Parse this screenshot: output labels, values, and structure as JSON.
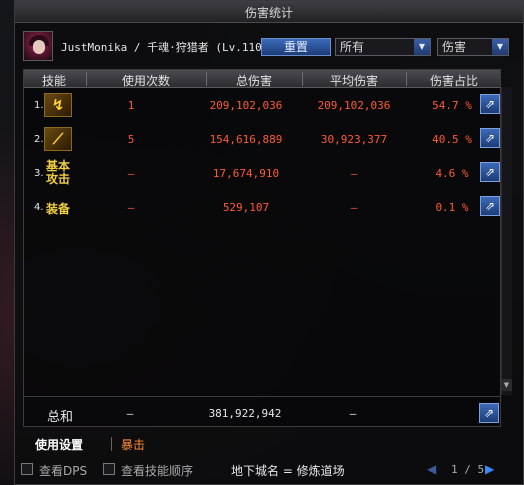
{
  "window": {
    "title": "伤害统计"
  },
  "player": {
    "name": "JustMonika / 千魂·狩猎者 (Lv.110)"
  },
  "controls": {
    "reset_label": "重置",
    "filter_select": "所有",
    "type_select": "伤害"
  },
  "table": {
    "headers": [
      "技能",
      "使用次数",
      "总伤害",
      "平均伤害",
      "伤害占比"
    ],
    "rows": [
      {
        "rank": "1.",
        "icon": "yellow-swirl-skill-icon",
        "uses": "1",
        "total": "209,102,036",
        "average": "209,102,036",
        "share": "54.7 %"
      },
      {
        "rank": "2.",
        "icon": "golden-spear-skill-icon",
        "uses": "5",
        "total": "154,616,889",
        "average": "30,923,377",
        "share": "40.5 %"
      },
      {
        "rank": "3.",
        "skill_name": "基本攻击",
        "uses": "–",
        "total": "17,674,910",
        "average": "–",
        "share": "4.6 %"
      },
      {
        "rank": "4.",
        "skill_name": "装备",
        "uses": "–",
        "total": "529,107",
        "average": "–",
        "share": "0.1 %"
      }
    ],
    "total": {
      "label": "总和",
      "uses": "–",
      "total": "381,922,942",
      "average": "–"
    }
  },
  "tabs": {
    "settings": "使用设置",
    "crit": "暴击"
  },
  "footer": {
    "view_dps": "查看DPS",
    "view_skill_order": "查看技能顺序",
    "dungeon": "地下城名 = 修炼道场",
    "page": "1 / 5"
  },
  "colors": {
    "accent_blue": "#3c6ab8",
    "damage_orange": "#ff5a34",
    "gold": "#f0d040"
  }
}
